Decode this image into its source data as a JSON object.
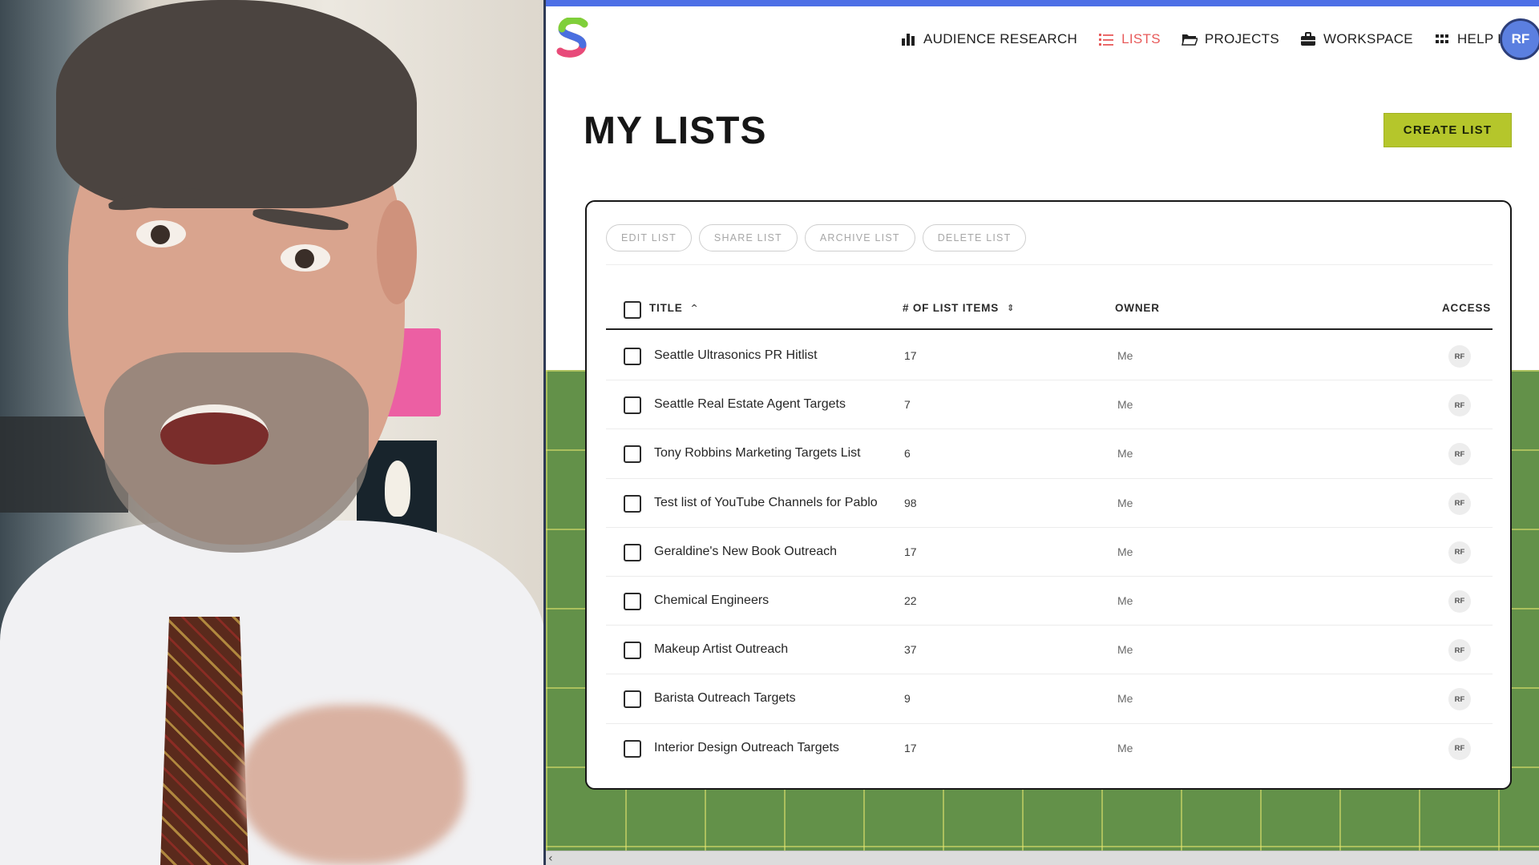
{
  "nav": {
    "items": [
      {
        "label": "AUDIENCE RESEARCH",
        "icon": "bar-chart-icon",
        "active": false
      },
      {
        "label": "LISTS",
        "icon": "list-icon",
        "active": true
      },
      {
        "label": "PROJECTS",
        "icon": "folder-icon",
        "active": false
      },
      {
        "label": "WORKSPACE",
        "icon": "briefcase-icon",
        "active": false
      },
      {
        "label": "HELP HUB",
        "icon": "grid-icon",
        "active": false
      }
    ],
    "avatar_initials": "RF"
  },
  "page": {
    "title": "MY LISTS",
    "create_button": "CREATE LIST"
  },
  "actions": {
    "edit": "EDIT LIST",
    "share": "SHARE LIST",
    "archive": "ARCHIVE LIST",
    "delete": "DELETE LIST"
  },
  "table": {
    "columns": {
      "title": "TITLE",
      "items": "# OF LIST ITEMS",
      "owner": "OWNER",
      "access": "ACCESS"
    },
    "rows": [
      {
        "title": "Seattle Ultrasonics PR Hitlist",
        "items": "17",
        "owner": "Me",
        "access": "RF"
      },
      {
        "title": "Seattle Real Estate Agent Targets",
        "items": "7",
        "owner": "Me",
        "access": "RF"
      },
      {
        "title": "Tony Robbins Marketing Targets List",
        "items": "6",
        "owner": "Me",
        "access": "RF"
      },
      {
        "title": "Test list of YouTube Channels for Pablo",
        "items": "98",
        "owner": "Me",
        "access": "RF"
      },
      {
        "title": "Geraldine's New Book Outreach",
        "items": "17",
        "owner": "Me",
        "access": "RF"
      },
      {
        "title": "Chemical Engineers",
        "items": "22",
        "owner": "Me",
        "access": "RF"
      },
      {
        "title": "Makeup Artist Outreach",
        "items": "37",
        "owner": "Me",
        "access": "RF"
      },
      {
        "title": "Barista Outreach Targets",
        "items": "9",
        "owner": "Me",
        "access": "RF"
      },
      {
        "title": "Interior Design Outreach Targets",
        "items": "17",
        "owner": "Me",
        "access": "RF"
      }
    ]
  },
  "colors": {
    "accent_top": "#4d6fe6",
    "active_nav": "#e85a5a",
    "create_button": "#b5c62b",
    "avatar": "#5b7fe0",
    "background_green": "#639149"
  }
}
